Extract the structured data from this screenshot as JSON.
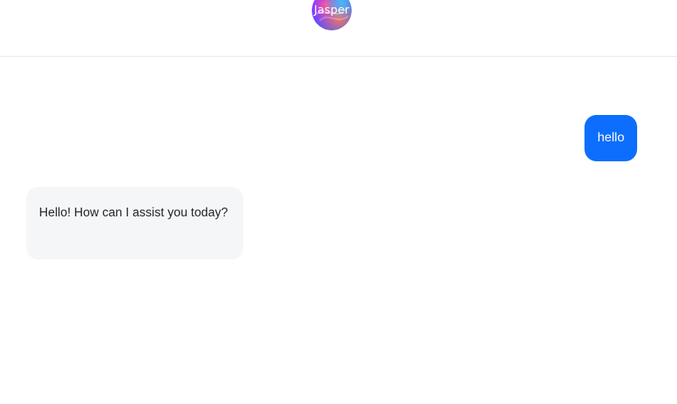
{
  "header": {
    "logo_text": "Jasper"
  },
  "chat": {
    "messages": [
      {
        "role": "user",
        "text": "hello"
      },
      {
        "role": "assistant",
        "text": "Hello! How can I assist you today?"
      }
    ]
  },
  "colors": {
    "user_bubble": "#0d6efd",
    "assistant_bubble": "#f5f6f8",
    "divider": "#e5e7eb"
  },
  "icons": {
    "logo": "jasper-logo-icon"
  }
}
